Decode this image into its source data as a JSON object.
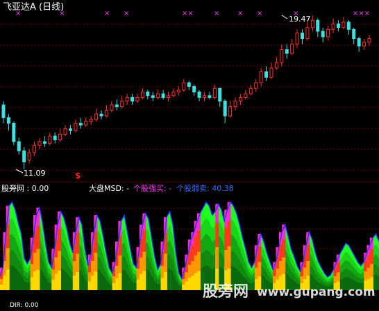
{
  "upper_panel": {
    "title": "飞亚达A (日线)",
    "high_label": "19.47",
    "low_label": "11.09",
    "signal_glyph": "$",
    "x_marks": [
      "×",
      "×",
      "×",
      "×",
      "××",
      "×",
      "×",
      "×",
      "×",
      "×××"
    ],
    "candles": [
      {
        "o": 14.6,
        "c": 13.9,
        "h": 14.8,
        "l": 13.6
      },
      {
        "o": 13.9,
        "c": 13.6,
        "h": 14.1,
        "l": 13.2
      },
      {
        "o": 13.6,
        "c": 12.6,
        "h": 13.7,
        "l": 12.4
      },
      {
        "o": 12.6,
        "c": 12.1,
        "h": 12.8,
        "l": 11.9
      },
      {
        "o": 12.1,
        "c": 11.5,
        "h": 12.3,
        "l": 11.09
      },
      {
        "o": 11.6,
        "c": 12.0,
        "h": 12.2,
        "l": 11.4
      },
      {
        "o": 12.0,
        "c": 12.4,
        "h": 12.6,
        "l": 11.8
      },
      {
        "o": 12.4,
        "c": 12.6,
        "h": 12.8,
        "l": 12.2
      },
      {
        "o": 12.6,
        "c": 12.5,
        "h": 12.9,
        "l": 12.3
      },
      {
        "o": 12.5,
        "c": 12.9,
        "h": 13.1,
        "l": 12.4
      },
      {
        "o": 12.9,
        "c": 12.7,
        "h": 13.1,
        "l": 12.5
      },
      {
        "o": 12.7,
        "c": 13.0,
        "h": 13.3,
        "l": 12.6
      },
      {
        "o": 13.0,
        "c": 13.3,
        "h": 13.5,
        "l": 12.9
      },
      {
        "o": 13.3,
        "c": 13.2,
        "h": 13.5,
        "l": 13.0
      },
      {
        "o": 13.2,
        "c": 13.6,
        "h": 13.8,
        "l": 13.1
      },
      {
        "o": 13.6,
        "c": 13.5,
        "h": 13.9,
        "l": 13.3
      },
      {
        "o": 13.5,
        "c": 13.7,
        "h": 13.9,
        "l": 13.4
      },
      {
        "o": 13.7,
        "c": 13.8,
        "h": 14.0,
        "l": 13.5
      },
      {
        "o": 13.8,
        "c": 14.1,
        "h": 14.4,
        "l": 13.7
      },
      {
        "o": 14.1,
        "c": 14.0,
        "h": 14.3,
        "l": 13.8
      },
      {
        "o": 14.0,
        "c": 14.3,
        "h": 14.6,
        "l": 13.9
      },
      {
        "o": 14.3,
        "c": 14.6,
        "h": 14.8,
        "l": 14.2
      },
      {
        "o": 14.6,
        "c": 14.5,
        "h": 14.9,
        "l": 14.3
      },
      {
        "o": 14.5,
        "c": 14.8,
        "h": 15.1,
        "l": 14.4
      },
      {
        "o": 14.8,
        "c": 15.0,
        "h": 15.2,
        "l": 14.6
      },
      {
        "o": 15.0,
        "c": 14.8,
        "h": 15.2,
        "l": 14.6
      },
      {
        "o": 14.8,
        "c": 15.0,
        "h": 15.2,
        "l": 14.7
      },
      {
        "o": 15.0,
        "c": 15.3,
        "h": 15.5,
        "l": 14.9
      },
      {
        "o": 15.3,
        "c": 15.1,
        "h": 15.4,
        "l": 14.9
      },
      {
        "o": 15.1,
        "c": 15.0,
        "h": 15.3,
        "l": 14.8
      },
      {
        "o": 15.0,
        "c": 15.2,
        "h": 15.4,
        "l": 14.9
      },
      {
        "o": 15.2,
        "c": 15.0,
        "h": 15.4,
        "l": 14.9
      },
      {
        "o": 15.0,
        "c": 15.1,
        "h": 15.3,
        "l": 14.8
      },
      {
        "o": 15.1,
        "c": 15.3,
        "h": 15.5,
        "l": 15.0
      },
      {
        "o": 15.3,
        "c": 15.4,
        "h": 15.6,
        "l": 15.1
      },
      {
        "o": 15.4,
        "c": 15.8,
        "h": 16.0,
        "l": 15.3
      },
      {
        "o": 15.8,
        "c": 15.6,
        "h": 15.9,
        "l": 15.4
      },
      {
        "o": 15.6,
        "c": 15.3,
        "h": 15.7,
        "l": 15.1
      },
      {
        "o": 15.3,
        "c": 15.0,
        "h": 15.4,
        "l": 14.8
      },
      {
        "o": 15.0,
        "c": 15.1,
        "h": 15.3,
        "l": 14.8
      },
      {
        "o": 15.1,
        "c": 15.0,
        "h": 15.3,
        "l": 14.9
      },
      {
        "o": 15.0,
        "c": 15.5,
        "h": 15.7,
        "l": 14.9
      },
      {
        "o": 15.5,
        "c": 14.8,
        "h": 15.5,
        "l": 14.5
      },
      {
        "o": 14.8,
        "c": 14.0,
        "h": 14.9,
        "l": 13.6
      },
      {
        "o": 14.0,
        "c": 14.5,
        "h": 14.8,
        "l": 13.9
      },
      {
        "o": 14.5,
        "c": 14.8,
        "h": 15.0,
        "l": 14.3
      },
      {
        "o": 14.8,
        "c": 15.0,
        "h": 15.2,
        "l": 14.6
      },
      {
        "o": 15.0,
        "c": 15.2,
        "h": 15.4,
        "l": 14.9
      },
      {
        "o": 15.2,
        "c": 15.5,
        "h": 15.7,
        "l": 15.1
      },
      {
        "o": 15.5,
        "c": 15.8,
        "h": 16.0,
        "l": 15.3
      },
      {
        "o": 15.8,
        "c": 16.4,
        "h": 16.6,
        "l": 15.6
      },
      {
        "o": 16.4,
        "c": 16.1,
        "h": 16.7,
        "l": 15.9
      },
      {
        "o": 16.1,
        "c": 16.6,
        "h": 16.9,
        "l": 16.0
      },
      {
        "o": 16.6,
        "c": 16.9,
        "h": 17.2,
        "l": 16.5
      },
      {
        "o": 16.9,
        "c": 17.6,
        "h": 17.9,
        "l": 16.7
      },
      {
        "o": 17.6,
        "c": 17.4,
        "h": 17.9,
        "l": 17.1
      },
      {
        "o": 17.4,
        "c": 17.9,
        "h": 18.2,
        "l": 17.3
      },
      {
        "o": 17.9,
        "c": 18.5,
        "h": 18.7,
        "l": 17.7
      },
      {
        "o": 18.5,
        "c": 18.2,
        "h": 18.7,
        "l": 17.9
      },
      {
        "o": 18.2,
        "c": 18.8,
        "h": 19.1,
        "l": 18.1
      },
      {
        "o": 18.8,
        "c": 19.2,
        "h": 19.47,
        "l": 18.6
      },
      {
        "o": 19.2,
        "c": 18.6,
        "h": 19.3,
        "l": 18.3
      },
      {
        "o": 18.6,
        "c": 18.3,
        "h": 18.8,
        "l": 18.0
      },
      {
        "o": 18.3,
        "c": 18.7,
        "h": 18.9,
        "l": 18.1
      },
      {
        "o": 18.7,
        "c": 19.0,
        "h": 19.3,
        "l": 18.5
      },
      {
        "o": 19.0,
        "c": 18.8,
        "h": 19.2,
        "l": 18.6
      },
      {
        "o": 18.8,
        "c": 19.1,
        "h": 19.4,
        "l": 18.7
      },
      {
        "o": 19.1,
        "c": 18.7,
        "h": 19.2,
        "l": 18.4
      },
      {
        "o": 18.7,
        "c": 18.2,
        "h": 18.8,
        "l": 17.9
      },
      {
        "o": 18.2,
        "c": 17.8,
        "h": 18.3,
        "l": 17.5
      },
      {
        "o": 17.8,
        "c": 18.0,
        "h": 18.2,
        "l": 17.6
      },
      {
        "o": 18.0,
        "c": 18.2,
        "h": 18.4,
        "l": 17.8
      }
    ]
  },
  "lower_panel": {
    "indicator_label": "股旁网 : 0.00",
    "msd_label": "大盘MSD: -",
    "strong_buy_label": "个股强买: -",
    "strong_sell_label": "个股弱卖: 40.38",
    "watermark": "股旁网",
    "watermark_url": "www.gupang.com",
    "bottom_label": "DIR: 0.00",
    "wave": [
      15,
      24,
      62,
      90,
      94,
      86,
      72,
      60,
      34,
      28,
      34,
      56,
      80,
      88,
      72,
      50,
      30,
      24,
      44,
      70,
      84,
      78,
      66,
      50,
      40,
      62,
      78,
      70,
      44,
      26,
      38,
      62,
      80,
      74,
      58,
      40,
      24,
      18,
      30,
      52,
      74,
      80,
      62,
      44,
      28,
      24,
      46,
      70,
      82,
      76,
      56,
      36,
      22,
      28,
      52,
      78,
      84,
      70,
      40,
      18,
      12,
      24,
      38,
      54,
      62,
      74,
      82,
      88,
      94,
      90,
      80,
      84,
      92,
      86,
      74,
      86,
      94,
      90,
      82,
      70,
      56,
      44,
      30,
      24,
      30,
      48,
      60,
      52,
      40,
      30,
      22,
      30,
      46,
      62,
      70,
      58,
      44,
      36,
      26,
      20,
      30,
      48,
      62,
      54,
      40,
      30,
      24,
      18,
      14,
      16,
      22,
      30,
      38,
      44,
      50,
      48,
      42,
      36,
      30,
      26,
      30,
      40,
      48,
      56,
      60,
      52
    ]
  },
  "colors": {
    "background": "#000000",
    "gridline": "#7a0000",
    "up_candle": "#ff3030",
    "down_candle": "#3fe0e0",
    "x_mark": "#ff3cff",
    "title_text": "#ffffff",
    "msd_label": "#ffffff",
    "strong_buy_label": "#ff3cff",
    "strong_sell_label": "#3a6cff",
    "signal_glyph": "#ff2020",
    "wave_outline": "#3030ff"
  }
}
